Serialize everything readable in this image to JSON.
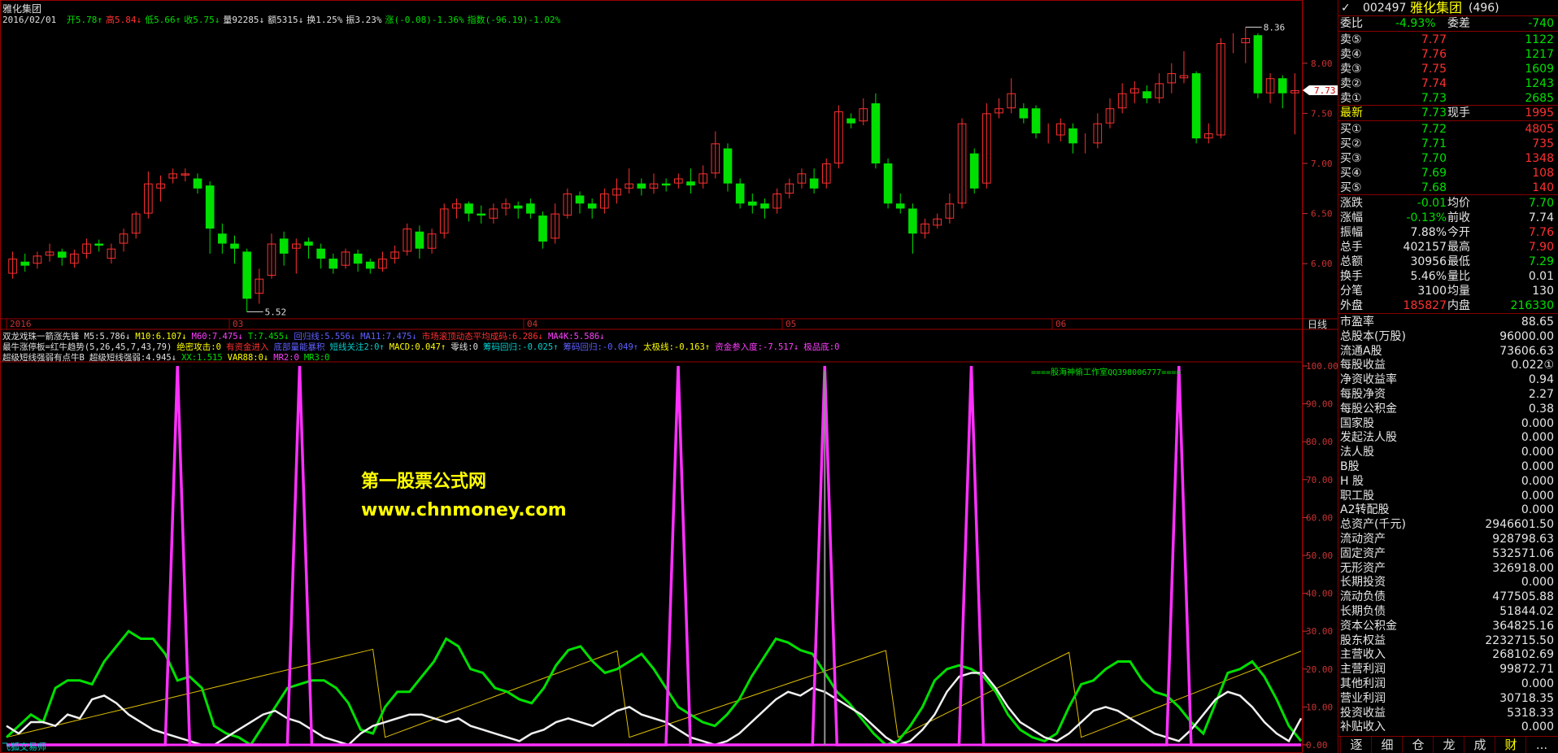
{
  "window_title": "雅化集团",
  "bar_info": {
    "date": "2016/02/01",
    "items": [
      {
        "t": "开5.78↑",
        "c": "#00e000"
      },
      {
        "t": "高5.84↓",
        "c": "#ff3030"
      },
      {
        "t": "低5.66↑",
        "c": "#00e000"
      },
      {
        "t": "收5.75↓",
        "c": "#00e000"
      },
      {
        "t": "量92285↓",
        "c": "#e0e0e0"
      },
      {
        "t": "额5315↓",
        "c": "#e0e0e0"
      },
      {
        "t": "换1.25%",
        "c": "#e0e0e0"
      },
      {
        "t": "振3.23%",
        "c": "#e0e0e0"
      },
      {
        "t": "涨(-0.08)-1.36%",
        "c": "#00e000"
      },
      {
        "t": "指数(-96.19)-1.02%",
        "c": "#00e000"
      }
    ]
  },
  "price_axis_labels": [
    "8.00",
    "7.50",
    "7.00",
    "6.50",
    "6.00"
  ],
  "current_price_tag": "7.73",
  "high_mark": "8.36",
  "low_mark": "5.52",
  "time_axis": {
    "labels": [
      "2016",
      "03",
      "04",
      "05",
      "06"
    ],
    "period": "日线"
  },
  "indicator_line1": [
    {
      "t": "双龙戏珠一箭涨先锋",
      "c": "#e0e0e0"
    },
    {
      "t": "M5:5.786↓",
      "c": "#e0e0e0"
    },
    {
      "t": "M10:6.107↓",
      "c": "#ffff00"
    },
    {
      "t": "M60:7.475↓",
      "c": "#ff40ff"
    },
    {
      "t": "T:7.455↓",
      "c": "#00e000"
    },
    {
      "t": "回归线:5.556↓",
      "c": "#6060ff"
    },
    {
      "t": "MA11:7.475↓",
      "c": "#6060ff"
    },
    {
      "t": "市场滚顶动态平均成码:6.286↓",
      "c": "#ff3030"
    },
    {
      "t": "MA4K:5.586↓",
      "c": "#ff40ff"
    }
  ],
  "indicator_line2": [
    {
      "t": "最牛涨停板=红牛趋势(5,26,45,7,43,79)",
      "c": "#e0e0e0"
    },
    {
      "t": "绝密攻击:0",
      "c": "#ffff00"
    },
    {
      "t": "有资金进入",
      "c": "#ff3030"
    },
    {
      "t": "底部量能暴积",
      "c": "#6060ff"
    },
    {
      "t": "短线关注2:0↑",
      "c": "#00d0d0"
    },
    {
      "t": "MACD:0.047↑",
      "c": "#ffff00"
    },
    {
      "t": "零线:0",
      "c": "#e0e0e0"
    },
    {
      "t": "筹码回归:-0.025↑",
      "c": "#00d0d0"
    },
    {
      "t": "筹码回归:-0.049↑",
      "c": "#6060ff"
    },
    {
      "t": "太极线:-0.163↑",
      "c": "#ffff00"
    },
    {
      "t": "资金参入度:-7.517↓",
      "c": "#ff40ff"
    },
    {
      "t": "极品底:0",
      "c": "#ff40ff"
    }
  ],
  "indicator_line3": [
    {
      "t": "超级短线强弱有点牛B",
      "c": "#e0e0e0"
    },
    {
      "t": "超级短线强弱:4.945↓",
      "c": "#e0e0e0"
    },
    {
      "t": "XX:1.515",
      "c": "#00e000"
    },
    {
      "t": "VAR88:0↓",
      "c": "#ffff00"
    },
    {
      "t": "MR2:0",
      "c": "#ff40ff"
    },
    {
      "t": "MR3:0",
      "c": "#00e000"
    }
  ],
  "indicator_axis_labels": [
    "100.00",
    "90.00",
    "80.00",
    "70.00",
    "60.00",
    "50.00",
    "40.00",
    "30.00",
    "20.00",
    "10.00",
    "0.00"
  ],
  "watermark_studio": "====股海神偷工作室QQ398006777====",
  "watermark_title": "第一股票公式网",
  "watermark_url": "www.chnmoney.com",
  "bottom_left_label": "飞狐交易师",
  "side_panel": {
    "code": "002497",
    "name": "雅化集团",
    "rank": "(496)",
    "weibi_label": "委比",
    "weibi_value": "-4.93%",
    "weicha_label": "委差",
    "weicha_value": "-740",
    "sells": [
      {
        "label": "卖⑤",
        "price": "7.77",
        "vol": "1122"
      },
      {
        "label": "卖④",
        "price": "7.76",
        "vol": "1217"
      },
      {
        "label": "卖③",
        "price": "7.75",
        "vol": "1609"
      },
      {
        "label": "卖②",
        "price": "7.74",
        "vol": "1243"
      },
      {
        "label": "卖①",
        "price": "7.73",
        "vol": "2685"
      }
    ],
    "latest_label": "最新",
    "latest_price": "7.73",
    "xianshou_label": "现手",
    "xianshou_value": "1995",
    "buys": [
      {
        "label": "买①",
        "price": "7.72",
        "vol": "4805"
      },
      {
        "label": "买②",
        "price": "7.71",
        "vol": "735"
      },
      {
        "label": "买③",
        "price": "7.70",
        "vol": "1348"
      },
      {
        "label": "买④",
        "price": "7.69",
        "vol": "108"
      },
      {
        "label": "买⑤",
        "price": "7.68",
        "vol": "140"
      }
    ],
    "stats": [
      {
        "l1": "涨跌",
        "v1": "-0.01",
        "c1": "#00e000",
        "l2": "均价",
        "v2": "7.70",
        "c2": "#00e000"
      },
      {
        "l1": "涨幅",
        "v1": "-0.13%",
        "c1": "#00e000",
        "l2": "前收",
        "v2": "7.74",
        "c2": "#e6e6e6"
      },
      {
        "l1": "振幅",
        "v1": "7.88%",
        "c1": "#e6e6e6",
        "l2": "今开",
        "v2": "7.76",
        "c2": "#ff3030"
      },
      {
        "l1": "总手",
        "v1": "402157",
        "c1": "#e6e6e6",
        "l2": "最高",
        "v2": "7.90",
        "c2": "#ff3030"
      },
      {
        "l1": "总额",
        "v1": "30956",
        "c1": "#e6e6e6",
        "l2": "最低",
        "v2": "7.29",
        "c2": "#00e000"
      },
      {
        "l1": "换手",
        "v1": "5.46%",
        "c1": "#e6e6e6",
        "l2": "量比",
        "v2": "0.01",
        "c2": "#e6e6e6"
      },
      {
        "l1": "分笔",
        "v1": "3100",
        "c1": "#e6e6e6",
        "l2": "均量",
        "v2": "130",
        "c2": "#e6e6e6"
      }
    ],
    "waipan_label": "外盘",
    "waipan_value": "185827",
    "neipan_label": "内盘",
    "neipan_value": "216330",
    "finance": [
      {
        "l": "市盈率",
        "v": "88.65"
      },
      {
        "l": "总股本(万股)",
        "v": "96000.00"
      },
      {
        "l": "流通A股",
        "v": "73606.63"
      },
      {
        "l": "每股收益",
        "v": "0.022①"
      },
      {
        "l": "净资收益率",
        "v": "0.94"
      },
      {
        "l": "每股净资",
        "v": "2.27"
      },
      {
        "l": "每股公积金",
        "v": "0.38"
      },
      {
        "l": "国家股",
        "v": "0.000"
      },
      {
        "l": "发起法人股",
        "v": "0.000"
      },
      {
        "l": "法人股",
        "v": "0.000"
      },
      {
        "l": "B股",
        "v": "0.000"
      },
      {
        "l": "H 股",
        "v": "0.000"
      },
      {
        "l": "职工股",
        "v": "0.000"
      },
      {
        "l": "A2转配股",
        "v": "0.000"
      },
      {
        "l": "总资产(千元)",
        "v": "2946601.50"
      },
      {
        "l": "流动资产",
        "v": "928798.63"
      },
      {
        "l": "固定资产",
        "v": "532571.06"
      },
      {
        "l": "无形资产",
        "v": "326918.00"
      },
      {
        "l": "长期投资",
        "v": "0.000"
      },
      {
        "l": "流动负债",
        "v": "477505.88"
      },
      {
        "l": "长期负债",
        "v": "51844.02"
      },
      {
        "l": "资本公积金",
        "v": "364825.16"
      },
      {
        "l": "股东权益",
        "v": "2232715.50"
      },
      {
        "l": "主营收入",
        "v": "268102.69"
      },
      {
        "l": "主营利润",
        "v": "99872.71"
      },
      {
        "l": "其他利润",
        "v": "0.000"
      },
      {
        "l": "营业利润",
        "v": "30718.35"
      },
      {
        "l": "投资收益",
        "v": "5318.33"
      },
      {
        "l": "补贴收入",
        "v": "0.000"
      }
    ],
    "tabs": [
      "逐",
      "细",
      "仓",
      "龙",
      "成",
      "财",
      "..."
    ]
  },
  "chart_data": {
    "type": "candlestick",
    "series_candles": [
      [
        5.9,
        6.05,
        6.12,
        5.85
      ],
      [
        6.02,
        5.98,
        6.1,
        5.92
      ],
      [
        6.0,
        6.08,
        6.12,
        5.95
      ],
      [
        6.08,
        6.12,
        6.2,
        6.02
      ],
      [
        6.12,
        6.06,
        6.15,
        5.98
      ],
      [
        6.0,
        6.1,
        6.14,
        5.96
      ],
      [
        6.1,
        6.2,
        6.25,
        6.05
      ],
      [
        6.2,
        6.18,
        6.24,
        6.12
      ],
      [
        6.05,
        6.15,
        6.2,
        6.0
      ],
      [
        6.2,
        6.3,
        6.35,
        6.12
      ],
      [
        6.3,
        6.5,
        6.52,
        6.25
      ],
      [
        6.5,
        6.8,
        6.92,
        6.45
      ],
      [
        6.75,
        6.8,
        6.88,
        6.62
      ],
      [
        6.85,
        6.9,
        6.95,
        6.8
      ],
      [
        6.88,
        6.9,
        6.95,
        6.82
      ],
      [
        6.85,
        6.75,
        6.9,
        6.7
      ],
      [
        6.78,
        6.35,
        6.82,
        6.1
      ],
      [
        6.3,
        6.2,
        6.4,
        6.1
      ],
      [
        6.2,
        6.15,
        6.28,
        6.0
      ],
      [
        6.12,
        5.65,
        6.15,
        5.52
      ],
      [
        5.7,
        5.85,
        5.95,
        5.6
      ],
      [
        5.88,
        6.2,
        6.3,
        5.85
      ],
      [
        6.25,
        6.1,
        6.32,
        5.98
      ],
      [
        6.15,
        6.2,
        6.25,
        5.9
      ],
      [
        6.22,
        6.18,
        6.26,
        6.05
      ],
      [
        6.15,
        6.05,
        6.2,
        5.95
      ],
      [
        6.05,
        5.95,
        6.1,
        5.9
      ],
      [
        5.98,
        6.12,
        6.15,
        5.95
      ],
      [
        6.1,
        6.0,
        6.14,
        5.92
      ],
      [
        6.02,
        5.95,
        6.05,
        5.9
      ],
      [
        5.95,
        6.05,
        6.12,
        5.92
      ],
      [
        6.05,
        6.12,
        6.18,
        6.0
      ],
      [
        6.12,
        6.35,
        6.4,
        6.08
      ],
      [
        6.32,
        6.15,
        6.38,
        6.05
      ],
      [
        6.15,
        6.3,
        6.35,
        6.1
      ],
      [
        6.3,
        6.55,
        6.6,
        6.25
      ],
      [
        6.55,
        6.6,
        6.65,
        6.45
      ],
      [
        6.6,
        6.5,
        6.62,
        6.42
      ],
      [
        6.5,
        6.48,
        6.58,
        6.4
      ],
      [
        6.45,
        6.55,
        6.6,
        6.4
      ],
      [
        6.55,
        6.6,
        6.65,
        6.48
      ],
      [
        6.58,
        6.55,
        6.62,
        6.45
      ],
      [
        6.6,
        6.5,
        6.65,
        6.45
      ],
      [
        6.48,
        6.22,
        6.52,
        6.15
      ],
      [
        6.25,
        6.5,
        6.6,
        6.2
      ],
      [
        6.48,
        6.7,
        6.75,
        6.45
      ],
      [
        6.68,
        6.6,
        6.72,
        6.5
      ],
      [
        6.6,
        6.55,
        6.65,
        6.45
      ],
      [
        6.55,
        6.7,
        6.75,
        6.5
      ],
      [
        6.68,
        6.75,
        6.85,
        6.6
      ],
      [
        6.75,
        6.8,
        6.95,
        6.7
      ],
      [
        6.8,
        6.75,
        6.85,
        6.68
      ],
      [
        6.75,
        6.8,
        6.9,
        6.7
      ],
      [
        6.8,
        6.78,
        6.85,
        6.72
      ],
      [
        6.8,
        6.85,
        6.9,
        6.75
      ],
      [
        6.82,
        6.78,
        6.95,
        6.7
      ],
      [
        6.8,
        6.9,
        6.98,
        6.75
      ],
      [
        6.9,
        7.2,
        7.32,
        6.85
      ],
      [
        7.15,
        6.8,
        7.2,
        6.72
      ],
      [
        6.8,
        6.6,
        6.85,
        6.55
      ],
      [
        6.62,
        6.58,
        6.7,
        6.5
      ],
      [
        6.6,
        6.55,
        6.65,
        6.45
      ],
      [
        6.55,
        6.7,
        6.75,
        6.5
      ],
      [
        6.7,
        6.8,
        6.85,
        6.65
      ],
      [
        6.8,
        6.9,
        6.95,
        6.75
      ],
      [
        6.85,
        6.75,
        6.95,
        6.7
      ],
      [
        6.8,
        7.0,
        7.05,
        6.75
      ],
      [
        7.0,
        7.52,
        7.58,
        6.95
      ],
      [
        7.45,
        7.4,
        7.5,
        7.35
      ],
      [
        7.42,
        7.55,
        7.65,
        7.38
      ],
      [
        7.6,
        7.0,
        7.7,
        6.95
      ],
      [
        7.0,
        6.6,
        7.05,
        6.55
      ],
      [
        6.6,
        6.55,
        6.7,
        6.5
      ],
      [
        6.55,
        6.3,
        6.6,
        6.1
      ],
      [
        6.3,
        6.4,
        6.45,
        6.25
      ],
      [
        6.38,
        6.45,
        6.5,
        6.35
      ],
      [
        6.45,
        6.6,
        6.7,
        6.4
      ],
      [
        6.6,
        7.4,
        7.45,
        6.55
      ],
      [
        7.1,
        6.75,
        7.15,
        6.7
      ],
      [
        6.8,
        7.5,
        7.6,
        6.75
      ],
      [
        7.5,
        7.55,
        7.65,
        7.45
      ],
      [
        7.55,
        7.7,
        7.85,
        7.5
      ],
      [
        7.55,
        7.45,
        7.6,
        7.4
      ],
      [
        7.55,
        7.3,
        7.58,
        7.25
      ],
      [
        7.3,
        7.3,
        7.4,
        7.2
      ],
      [
        7.28,
        7.4,
        7.45,
        7.22
      ],
      [
        7.35,
        7.2,
        7.4,
        7.1
      ],
      [
        7.2,
        7.2,
        7.3,
        7.1
      ],
      [
        7.2,
        7.4,
        7.5,
        7.15
      ],
      [
        7.4,
        7.55,
        7.65,
        7.35
      ],
      [
        7.55,
        7.7,
        7.8,
        7.5
      ],
      [
        7.7,
        7.75,
        7.82,
        7.6
      ],
      [
        7.72,
        7.65,
        7.78,
        7.6
      ],
      [
        7.65,
        7.8,
        7.9,
        7.6
      ],
      [
        7.8,
        7.9,
        8.0,
        7.7
      ],
      [
        7.85,
        7.88,
        8.12,
        7.8
      ],
      [
        7.9,
        7.25,
        7.92,
        7.2
      ],
      [
        7.25,
        7.3,
        7.4,
        7.2
      ],
      [
        7.28,
        8.2,
        8.25,
        7.25
      ],
      [
        8.2,
        8.2,
        8.3,
        8.1
      ],
      [
        8.2,
        8.25,
        8.36,
        8.0
      ],
      [
        8.28,
        7.7,
        8.3,
        7.65
      ],
      [
        7.7,
        7.85,
        7.9,
        7.6
      ],
      [
        7.85,
        7.7,
        7.88,
        7.55
      ],
      [
        7.7,
        7.73,
        7.9,
        7.29
      ]
    ],
    "indicator_series": {
      "white": [
        5,
        3,
        6,
        6,
        5,
        8,
        7,
        12,
        13,
        11,
        8,
        6,
        4,
        3,
        2,
        1,
        0,
        0,
        2,
        4,
        6,
        8,
        9,
        7,
        6,
        4,
        2,
        1,
        0,
        3,
        5,
        6,
        7,
        8,
        8,
        7,
        6,
        7,
        5,
        4,
        3,
        2,
        1,
        3,
        4,
        6,
        7,
        6,
        5,
        7,
        9,
        10,
        8,
        7,
        6,
        4,
        2,
        1,
        0,
        1,
        3,
        6,
        9,
        12,
        14,
        13,
        15,
        14,
        12,
        10,
        8,
        5,
        2,
        0,
        1,
        4,
        8,
        14,
        18,
        19,
        19,
        15,
        10,
        6,
        4,
        2,
        1,
        3,
        6,
        9,
        10,
        9,
        7,
        5,
        3,
        2,
        1,
        4,
        8,
        12,
        14,
        13,
        10,
        6,
        3,
        1,
        7
      ],
      "green": [
        2,
        5,
        8,
        6,
        15,
        17,
        17,
        16,
        22,
        26,
        30,
        28,
        28,
        24,
        17,
        18,
        15,
        5,
        3,
        2,
        0,
        5,
        10,
        15,
        16,
        17,
        17,
        15,
        11,
        4,
        3,
        10,
        14,
        14,
        18,
        22,
        28,
        26,
        20,
        19,
        15,
        14,
        12,
        11,
        15,
        21,
        25,
        26,
        22,
        19,
        20,
        22,
        24,
        20,
        15,
        10,
        8,
        6,
        5,
        8,
        12,
        18,
        23,
        28,
        27,
        25,
        24,
        19,
        14,
        11,
        7,
        3,
        0,
        1,
        5,
        10,
        17,
        20,
        21,
        20,
        18,
        14,
        8,
        4,
        2,
        1,
        3,
        10,
        16,
        17,
        20,
        22,
        22,
        17,
        14,
        13,
        10,
        6,
        3,
        11,
        19,
        20,
        22,
        18,
        12,
        5,
        1
      ]
    }
  }
}
